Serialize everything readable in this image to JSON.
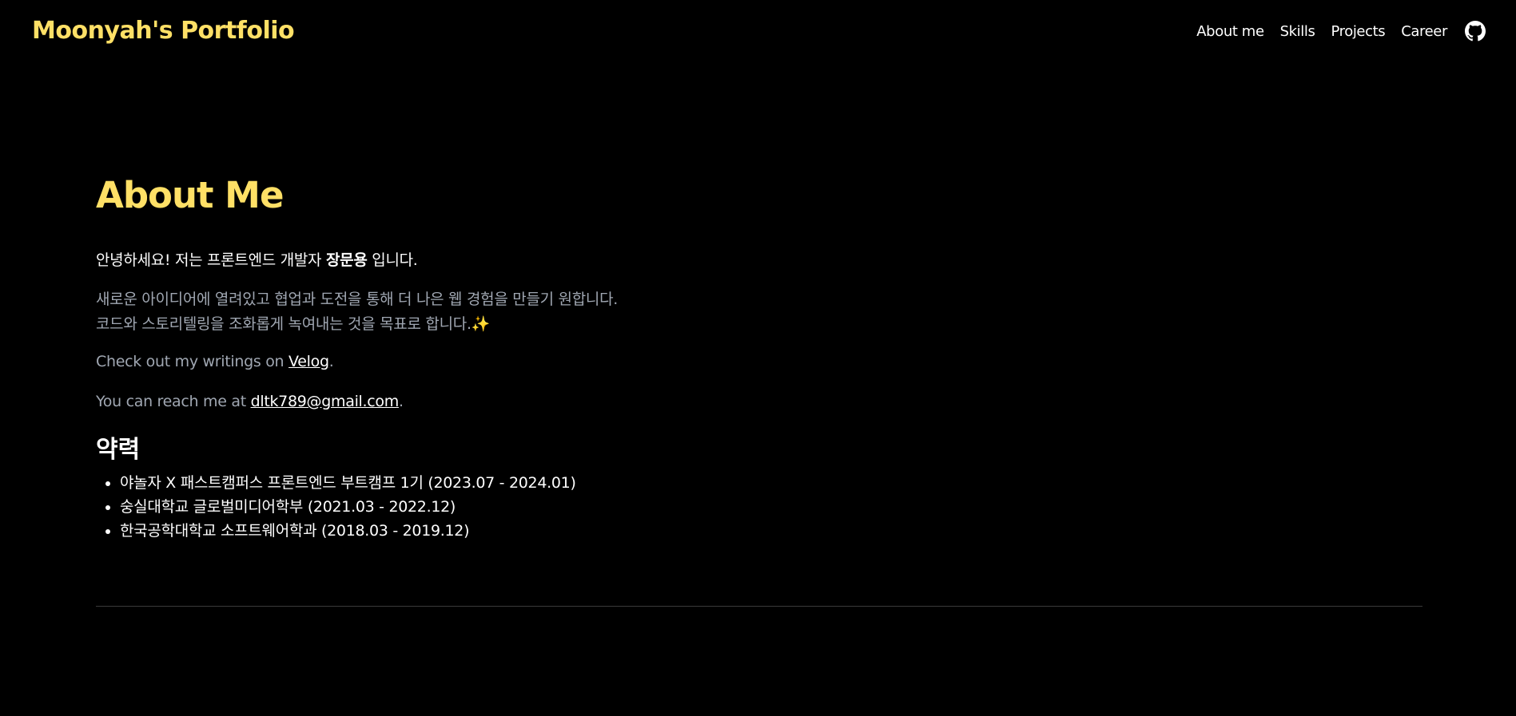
{
  "header": {
    "brand": "Moonyah's Portfolio",
    "nav": [
      {
        "label": "About me"
      },
      {
        "label": "Skills"
      },
      {
        "label": "Projects"
      },
      {
        "label": "Career"
      }
    ],
    "github_icon": "github-icon"
  },
  "about": {
    "title": "About Me",
    "intro_prefix": "안녕하세요! 저는 프론트엔드 개발자 ",
    "intro_name": "장문용",
    "intro_suffix": " 입니다.",
    "desc_line1": "새로운 아이디어에 열려있고 협업과 도전을 통해 더 나은 웹 경험을 만들기 원합니다.",
    "desc_line2": "코드와 스토리텔링을 조화롭게 녹여내는 것을 목표로 합니다.✨",
    "writing_prefix": "Check out my writings on ",
    "writing_link": "Velog",
    "writing_suffix": ".",
    "contact_prefix": "You can reach me at ",
    "contact_link": "dltk789@gmail.com",
    "contact_suffix": "."
  },
  "career": {
    "title": "약력",
    "items": [
      "야놀자 X 패스트캠퍼스 프론트엔드 부트캠프 1기 (2023.07 - 2024.01)",
      "숭실대학교 글로벌미디어학부 (2021.03 - 2022.12)",
      "한국공학대학교 소프트웨어학과 (2018.03 - 2019.12)"
    ]
  },
  "colors": {
    "accent": "#ffe066",
    "background": "#000000",
    "muted_text": "#a0a7b2"
  }
}
